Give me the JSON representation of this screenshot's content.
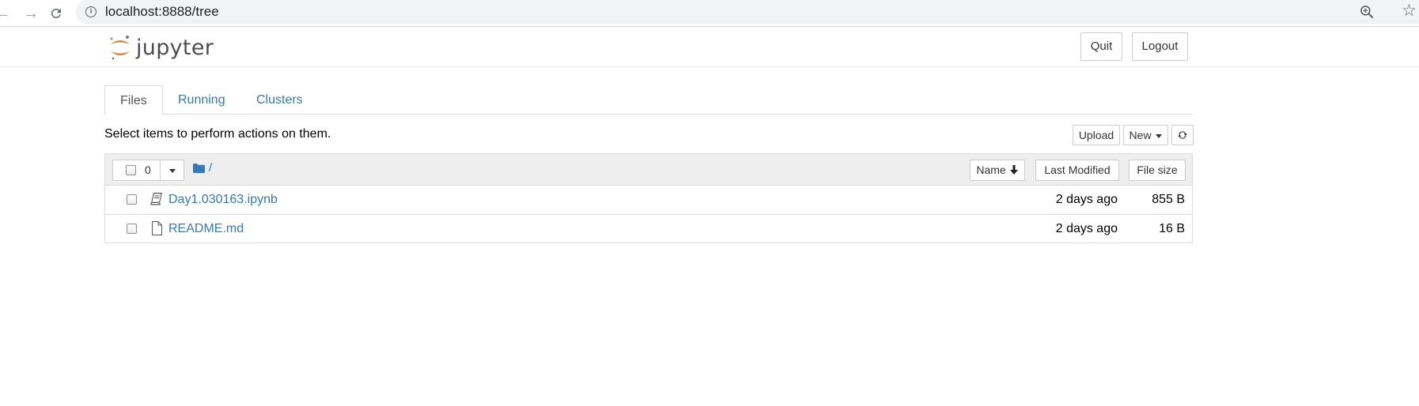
{
  "browser": {
    "url": "localhost:8888/tree"
  },
  "header": {
    "logo_text": "jupyter",
    "quit_label": "Quit",
    "logout_label": "Logout"
  },
  "tabs": [
    {
      "label": "Files",
      "active": true
    },
    {
      "label": "Running",
      "active": false
    },
    {
      "label": "Clusters",
      "active": false
    }
  ],
  "toolbar": {
    "message": "Select items to perform actions on them.",
    "upload_label": "Upload",
    "new_label": "New"
  },
  "list": {
    "selected_count": "0",
    "breadcrumb": "/",
    "sort_name_label": "Name",
    "sort_modified_label": "Last Modified",
    "sort_size_label": "File size",
    "files": [
      {
        "name": "Day1.030163.ipynb",
        "type": "notebook",
        "modified": "2 days ago",
        "size": "855 B"
      },
      {
        "name": "README.md",
        "type": "file",
        "modified": "2 days ago",
        "size": "16 B"
      }
    ]
  },
  "colors": {
    "link": "#337ab7",
    "logo_orange": "#f37726",
    "folder": "#337ab7"
  }
}
